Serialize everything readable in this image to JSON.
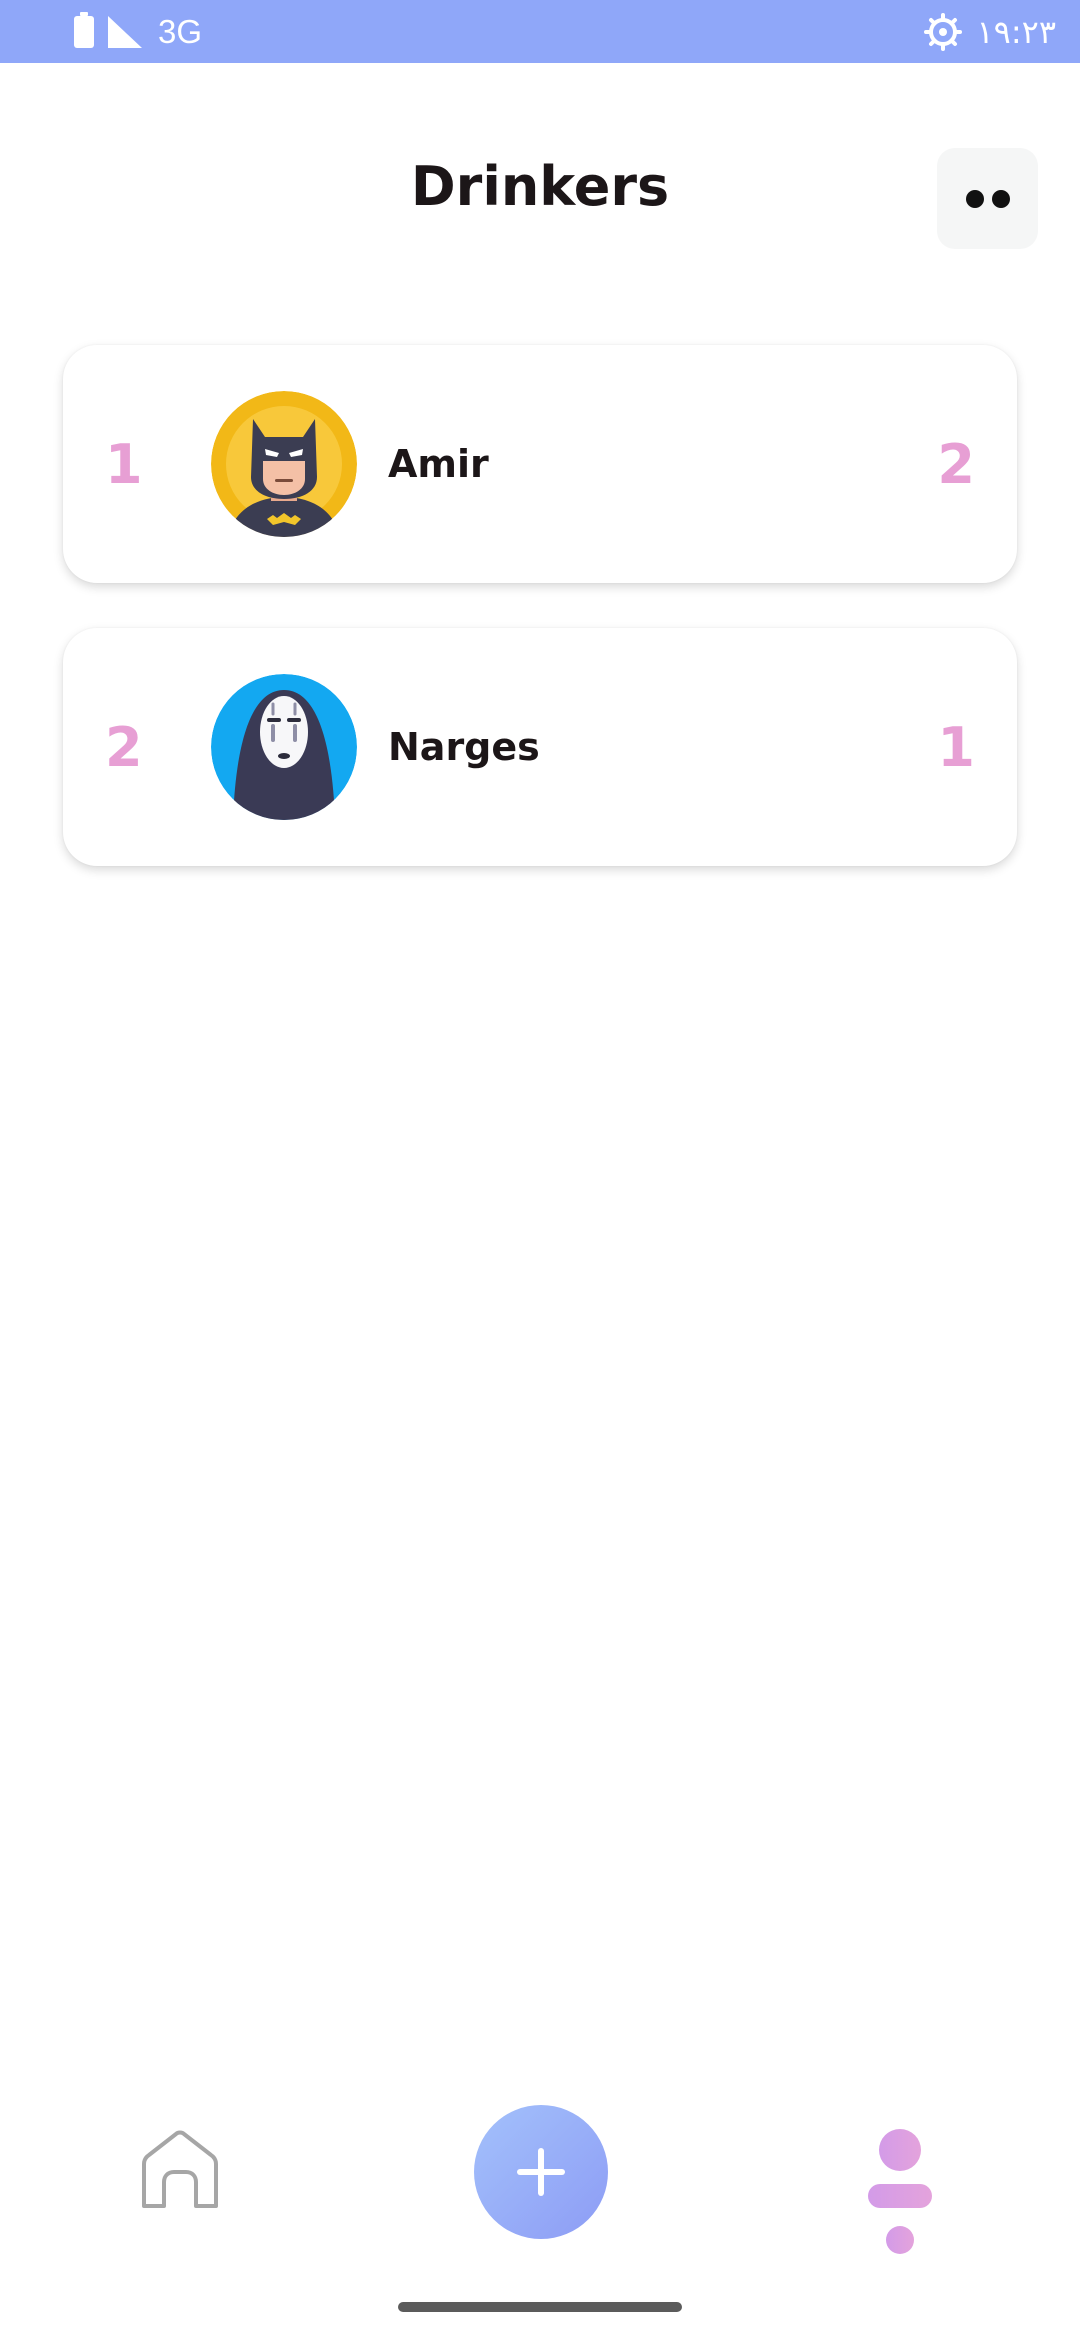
{
  "status_bar": {
    "network": "3G",
    "time": "۱۹:۲۳",
    "icons": [
      "battery-icon",
      "signal-icon",
      "gear-icon"
    ]
  },
  "header": {
    "title": "Drinkers",
    "more_icon": "more-dots-icon"
  },
  "drinkers": [
    {
      "rank": "1",
      "name": "Amir",
      "count": "2",
      "avatar": "batman-avatar"
    },
    {
      "rank": "2",
      "name": "Narges",
      "count": "1",
      "avatar": "no-face-avatar"
    }
  ],
  "bottom_nav": {
    "items": [
      "home-icon",
      "add-icon",
      "profile-icon"
    ]
  },
  "colors": {
    "status_bar": "#8fa7f9",
    "accent_pink": "#e79fd4",
    "add_button_start": "#a3c1fb",
    "add_button_end": "#8d9cf5",
    "profile_icon": "#d89be4"
  }
}
